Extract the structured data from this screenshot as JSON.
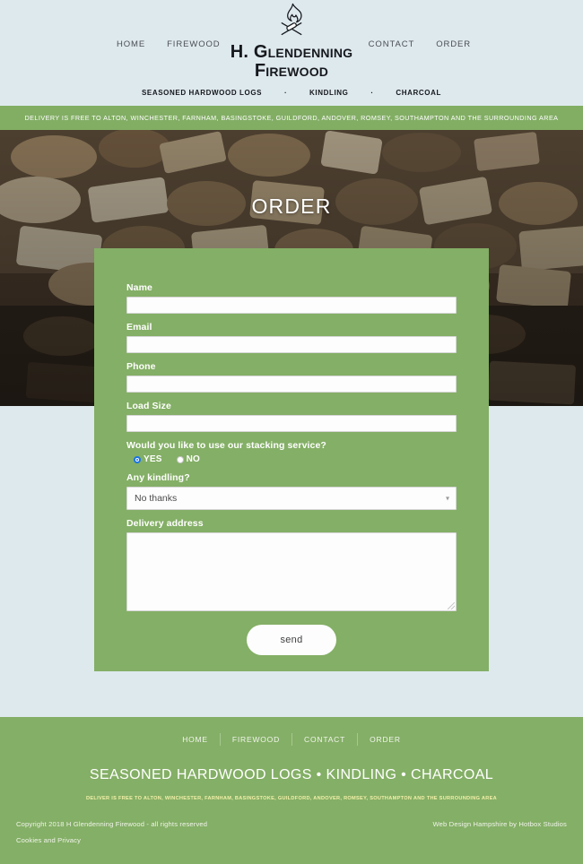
{
  "colors": {
    "page_background": "#dee9ee",
    "brand_green": "#84af66",
    "banner_green": "#82ae64",
    "heading_dark": "#15181c",
    "radio_accent": "#1a73e8",
    "footer_sub_yellow": "#f3f0a8"
  },
  "header": {
    "logo_icon": "campfire-icon",
    "brand_line1": "H. Glendenning",
    "brand_line2": "Firewood",
    "nav_left": [
      {
        "label": "HOME",
        "name": "nav-link-home"
      },
      {
        "label": "FIREWOOD",
        "name": "nav-link-firewood"
      }
    ],
    "nav_right": [
      {
        "label": "CONTACT",
        "name": "nav-link-contact"
      },
      {
        "label": "ORDER",
        "name": "nav-link-order"
      }
    ],
    "tagline": {
      "item1": "SEASONED HARDWOOD LOGS",
      "sep1": "·",
      "item2": "KINDLING",
      "sep2": "·",
      "item3": "CHARCOAL"
    }
  },
  "delivery_banner": {
    "text": "DELIVERY IS FREE TO ALTON, WINCHESTER, FARNHAM, BASINGSTOKE, GUILDFORD, ANDOVER, ROMSEY, SOUTHAMPTON AND THE SURROUNDING AREA"
  },
  "hero": {
    "title": "ORDER",
    "image_description": "stacked-cut-firewood-logs-photo"
  },
  "form": {
    "name": {
      "label": "Name",
      "value": "",
      "placeholder": ""
    },
    "email": {
      "label": "Email",
      "value": "",
      "placeholder": ""
    },
    "phone": {
      "label": "Phone",
      "value": "",
      "placeholder": ""
    },
    "load_size": {
      "label": "Load Size",
      "value": "",
      "placeholder": ""
    },
    "stacking": {
      "label": "Would you like to use our stacking service?",
      "options": [
        {
          "label": "YES",
          "selected": true
        },
        {
          "label": "NO",
          "selected": false
        }
      ]
    },
    "kindling": {
      "label": "Any kindling?",
      "selected": "No thanks",
      "caret_icon": "chevron-down-icon"
    },
    "delivery_address": {
      "label": "Delivery address",
      "value": "",
      "placeholder": ""
    },
    "submit_label": "send"
  },
  "footer": {
    "nav": [
      {
        "label": "HOME",
        "name": "footer-link-home"
      },
      {
        "label": "FIREWOOD",
        "name": "footer-link-firewood"
      },
      {
        "label": "CONTACT",
        "name": "footer-link-contact"
      },
      {
        "label": "ORDER",
        "name": "footer-link-order"
      }
    ],
    "headline": "SEASONED HARDWOOD LOGS • KINDLING • CHARCOAL",
    "subline": "DELIVER IS FREE TO ALTON, WINCHESTER, FARNHAM, BASINGSTOKE, GUILDFORD, ANDOVER, ROMSEY, SOUTHAMPTON AND THE SURROUNDING AREA",
    "copyright": "Copyright 2018 H Glendenning Firewood - all rights reserved",
    "cookies_link": "Cookies and Privacy",
    "credit": "Web Design Hampshire by Hotbox Studios"
  }
}
